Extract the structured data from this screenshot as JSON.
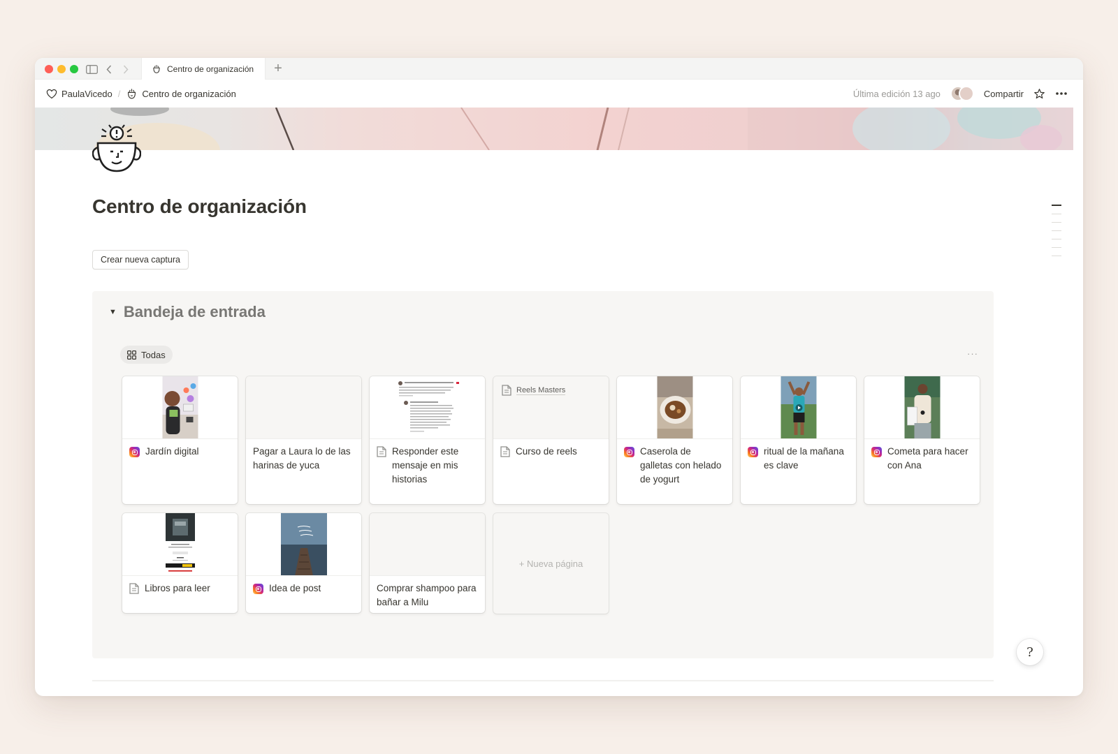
{
  "browser": {
    "tab_title": "Centro de organización",
    "new_tab_icon": "plus-icon"
  },
  "topbar": {
    "workspace": "PaulaVicedo",
    "page": "Centro de organización",
    "last_edited": "Última edición 13 ago",
    "share_label": "Compartir"
  },
  "page": {
    "title": "Centro de organización",
    "capture_button": "Crear nueva captura"
  },
  "inbox": {
    "title": "Bandeja de entrada",
    "view_label": "Todas",
    "more_label": "···",
    "new_page_label": "+ Nueva página",
    "cards": [
      {
        "label": "Jardín digital",
        "icon": "instagram-icon",
        "cover": "photo"
      },
      {
        "label": "Pagar a Laura lo de las harinas de yuca",
        "icon": "none",
        "cover": "blank"
      },
      {
        "label": "Responder este mensaje en mis historias",
        "icon": "page-icon",
        "cover": "message-screenshot"
      },
      {
        "label": "Curso de reels",
        "icon": "page-icon",
        "cover": "note",
        "cover_text": "Reels Masters"
      },
      {
        "label": "Caserola de galletas con helado de yogurt",
        "icon": "instagram-icon",
        "cover": "photo"
      },
      {
        "label": "ritual de la mañana es clave",
        "icon": "instagram-icon",
        "cover": "photo"
      },
      {
        "label": "Cometa para hacer con Ana",
        "icon": "instagram-icon",
        "cover": "photo"
      },
      {
        "label": "Libros para leer",
        "icon": "page-icon",
        "cover": "book-screenshot"
      },
      {
        "label": "Idea de post",
        "icon": "instagram-icon",
        "cover": "photo"
      },
      {
        "label": "Comprar shampoo para bañar a Milu",
        "icon": "none",
        "cover": "blank"
      }
    ]
  },
  "help_label": "?"
}
